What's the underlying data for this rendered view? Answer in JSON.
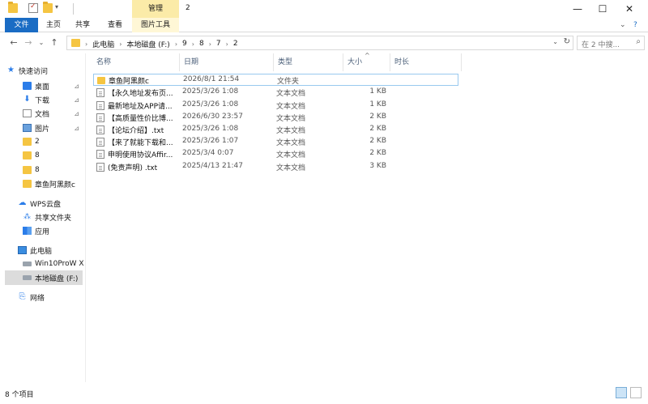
{
  "window": {
    "title": "2",
    "contextual_group": "管理",
    "controls": {
      "minimize": "—",
      "maximize": "☐",
      "close": "✕"
    },
    "help": "?"
  },
  "ribbon": {
    "tabs": [
      "文件",
      "主页",
      "共享",
      "查看",
      "图片工具"
    ],
    "collapse": "⌄"
  },
  "address": {
    "back": "←",
    "forward": "→",
    "history": "⌄",
    "up": "↑",
    "crumbs": [
      "此电脑",
      "本地磁盘 (F:)",
      "9",
      "8",
      "7",
      "2"
    ],
    "refresh": "↻",
    "search_placeholder": "在 2 中搜..."
  },
  "navpane": {
    "items": [
      {
        "label": "快速访问",
        "icon": "star-icon",
        "pinned": false
      },
      {
        "label": "桌面",
        "icon": "desktop-icon",
        "pinned": true
      },
      {
        "label": "下载",
        "icon": "download-icon",
        "pinned": true
      },
      {
        "label": "文档",
        "icon": "document-icon",
        "pinned": true
      },
      {
        "label": "图片",
        "icon": "pictures-icon",
        "pinned": true
      },
      {
        "label": "2",
        "icon": "folder-icon",
        "pinned": false
      },
      {
        "label": "8",
        "icon": "folder-icon",
        "pinned": false
      },
      {
        "label": "8",
        "icon": "folder-icon",
        "pinned": false
      },
      {
        "label": "章鱼阿黑颜c",
        "icon": "folder-icon",
        "pinned": false
      },
      {
        "label": "WPS云盘",
        "icon": "cloud-icon",
        "pinned": false
      },
      {
        "label": "共享文件夹",
        "icon": "share-icon",
        "pinned": false
      },
      {
        "label": "应用",
        "icon": "apps-icon",
        "pinned": false
      },
      {
        "label": "此电脑",
        "icon": "pc-icon",
        "pinned": false
      },
      {
        "label": "Win10ProW X",
        "icon": "drive-icon",
        "pinned": false
      },
      {
        "label": "本地磁盘 (F:)",
        "icon": "drive-icon",
        "pinned": false
      },
      {
        "label": "网络",
        "icon": "network-icon",
        "pinned": false
      }
    ],
    "pin_glyph": "📌"
  },
  "list": {
    "columns": [
      "名称",
      "日期",
      "类型",
      "大小",
      "时长"
    ],
    "sort_glyph": "^",
    "rows": [
      {
        "name": "章鱼阿黑颜c",
        "date": "2026/8/1 21:54",
        "type": "文件夹",
        "size": "",
        "icon": "folder-icon"
      },
      {
        "name": "【永久地址发布页...",
        "date": "2025/3/26 1:08",
        "type": "文本文档",
        "size": "1 KB",
        "icon": "text-file-icon"
      },
      {
        "name": "最新地址及APP请...",
        "date": "2025/3/26 1:08",
        "type": "文本文档",
        "size": "1 KB",
        "icon": "text-file-icon"
      },
      {
        "name": "【高质量性价比博...",
        "date": "2026/6/30 23:57",
        "type": "文本文档",
        "size": "2 KB",
        "icon": "text-file-icon"
      },
      {
        "name": "【论坛介绍】.txt",
        "date": "2025/3/26 1:08",
        "type": "文本文档",
        "size": "2 KB",
        "icon": "text-file-icon"
      },
      {
        "name": "【来了就能下载和...",
        "date": "2025/3/26 1:07",
        "type": "文本文档",
        "size": "2 KB",
        "icon": "text-file-icon"
      },
      {
        "name": "申明使用协议Affir...",
        "date": "2025/3/4 0:07",
        "type": "文本文档",
        "size": "2 KB",
        "icon": "text-file-icon"
      },
      {
        "name": "(免责声明) .txt",
        "date": "2025/4/13 21:47",
        "type": "文本文档",
        "size": "3 KB",
        "icon": "text-file-icon"
      }
    ]
  },
  "status": {
    "count": "8 个项目"
  },
  "colors": {
    "accent": "#1a6cc4",
    "manage_tab": "#fbeba8",
    "selection_border": "#99c9ef",
    "folder": "#f5c542"
  }
}
